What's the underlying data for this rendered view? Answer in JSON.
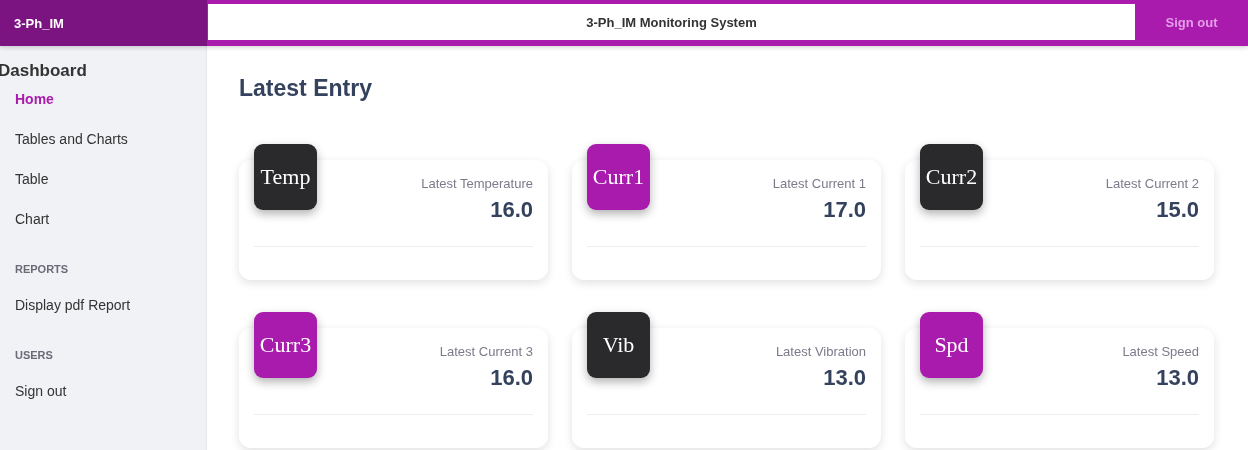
{
  "brand": "3-Ph_IM",
  "header": {
    "title": "3-Ph_IM Monitoring System",
    "sign_out": "Sign out"
  },
  "sidebar": {
    "title": "Dashboard",
    "groups": [
      {
        "items": [
          {
            "label": "Home",
            "selected": true
          },
          {
            "label": "Tables and Charts",
            "selected": false
          },
          {
            "label": "Table",
            "selected": false
          },
          {
            "label": "Chart",
            "selected": false
          }
        ]
      },
      {
        "heading": "REPORTS",
        "items": [
          {
            "label": "Display pdf Report",
            "selected": false
          }
        ]
      },
      {
        "heading": "USERS",
        "items": [
          {
            "label": "Sign out",
            "selected": false
          }
        ]
      }
    ]
  },
  "page_title": "Latest Entry",
  "cards": [
    {
      "icon_text": "Temp",
      "color": "#2a2a2d",
      "label": "Latest Temperature",
      "value": "16.0"
    },
    {
      "icon_text": "Curr1",
      "color": "#a91bad",
      "label": "Latest Current 1",
      "value": "17.0"
    },
    {
      "icon_text": "Curr2",
      "color": "#2a2a2d",
      "label": "Latest Current 2",
      "value": "15.0"
    },
    {
      "icon_text": "Curr3",
      "color": "#a91bad",
      "label": "Latest Current 3",
      "value": "16.0"
    },
    {
      "icon_text": "Vib",
      "color": "#2a2a2d",
      "label": "Latest Vibration",
      "value": "13.0"
    },
    {
      "icon_text": "Spd",
      "color": "#a91bad",
      "label": "Latest Speed",
      "value": "13.0"
    }
  ]
}
